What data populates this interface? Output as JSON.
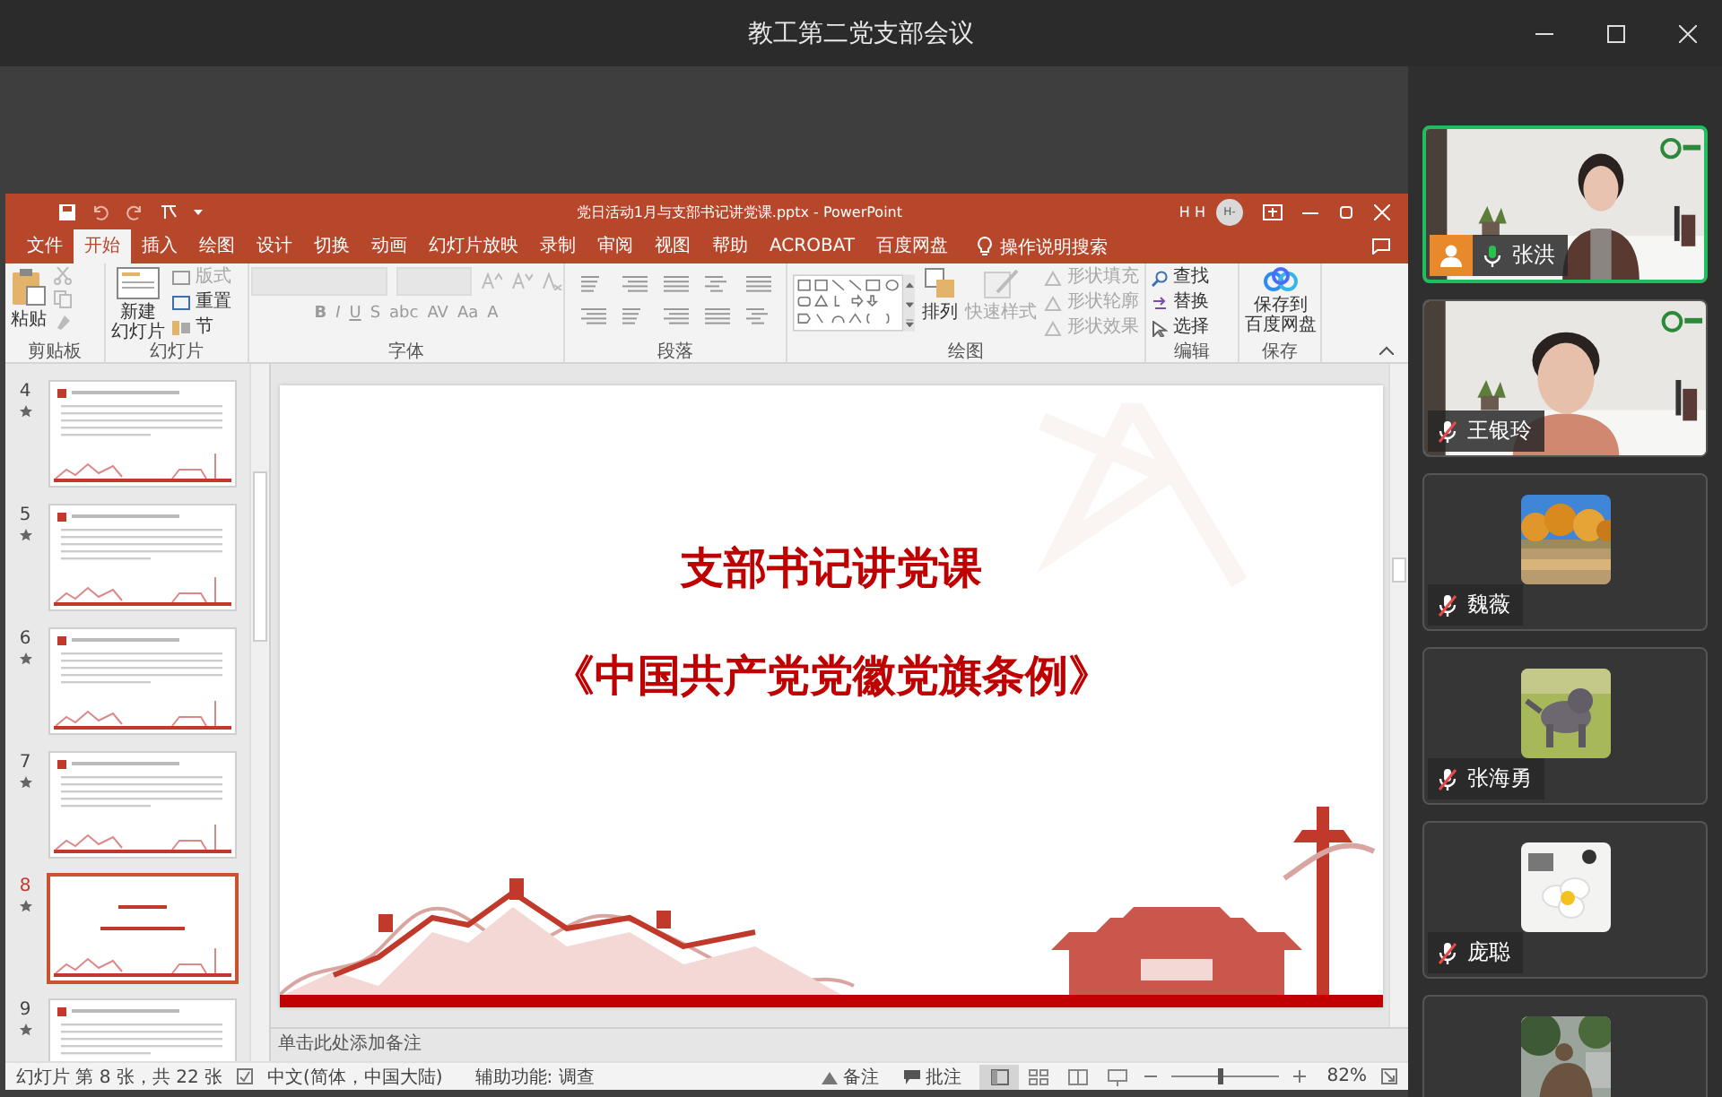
{
  "app": {
    "title": "教工第二党支部会议"
  },
  "powerpoint": {
    "title": "党日活动1月与支部书记讲党课.pptx  -  PowerPoint",
    "user_initials": "H H",
    "avatar": "H-",
    "tabs": [
      {
        "label": "文件",
        "selected": false
      },
      {
        "label": "开始",
        "selected": true
      },
      {
        "label": "插入",
        "selected": false
      },
      {
        "label": "绘图",
        "selected": false
      },
      {
        "label": "设计",
        "selected": false
      },
      {
        "label": "切换",
        "selected": false
      },
      {
        "label": "动画",
        "selected": false
      },
      {
        "label": "幻灯片放映",
        "selected": false
      },
      {
        "label": "录制",
        "selected": false
      },
      {
        "label": "审阅",
        "selected": false
      },
      {
        "label": "视图",
        "selected": false
      },
      {
        "label": "帮助",
        "selected": false
      },
      {
        "label": "ACROBAT",
        "selected": false
      },
      {
        "label": "百度网盘",
        "selected": false
      }
    ],
    "tell_me": "操作说明搜索",
    "ribbon": {
      "clipboard": {
        "paste": "粘贴",
        "label": "剪贴板"
      },
      "slides": {
        "new_slide": [
          "新建",
          "幻灯片"
        ],
        "layout": "版式",
        "reset": "重置",
        "section": "节",
        "label": "幻灯片"
      },
      "font": {
        "buttons": [
          "B",
          "I",
          "U",
          "S",
          "abc",
          "AV",
          "Aa",
          "A"
        ],
        "label": "字体"
      },
      "paragraph": {
        "label": "段落"
      },
      "drawing": {
        "arrange": "排列",
        "quick_styles": "快速样式",
        "shape_options": [
          "形状填充",
          "形状轮廓",
          "形状效果"
        ],
        "label": "绘图"
      },
      "editing": {
        "items": [
          "查找",
          "替换",
          "选择"
        ],
        "label": "编辑"
      },
      "save": {
        "button": [
          "保存到",
          "百度网盘"
        ],
        "label": "保存"
      }
    },
    "thumbnails": [
      {
        "number": "4",
        "kind": "text",
        "selected": false
      },
      {
        "number": "5",
        "kind": "text",
        "selected": false
      },
      {
        "number": "6",
        "kind": "text",
        "selected": false
      },
      {
        "number": "7",
        "kind": "text",
        "selected": false
      },
      {
        "number": "8",
        "kind": "title",
        "selected": true
      },
      {
        "number": "9",
        "kind": "text",
        "selected": false
      }
    ],
    "slide": {
      "title": "支部书记讲党课",
      "subtitle": "《中国共产党党徽党旗条例》"
    },
    "notes_placeholder": "单击此处添加备注",
    "status_bar": {
      "slide_info": "幻灯片 第 8 张，共 22 张",
      "language": "中文(简体，中国大陆)",
      "accessibility": "辅助功能: 调查",
      "notes": "备注",
      "comments": "批注",
      "zoom": "82%",
      "zoom_slider": {
        "level": 0.45
      }
    }
  },
  "participants": [
    {
      "name": "张洪",
      "kind": "video",
      "muted": false,
      "speaking": true,
      "host": true
    },
    {
      "name": "王银玲",
      "kind": "video",
      "muted": true,
      "speaking": false,
      "host": false
    },
    {
      "name": "魏薇",
      "kind": "avatar",
      "muted": true,
      "speaking": false,
      "host": false
    },
    {
      "name": "张海勇",
      "kind": "avatar",
      "muted": true,
      "speaking": false,
      "host": false
    },
    {
      "name": "庞聪",
      "kind": "avatar",
      "muted": true,
      "speaking": false,
      "host": false
    },
    {
      "kind": "avatar"
    }
  ]
}
